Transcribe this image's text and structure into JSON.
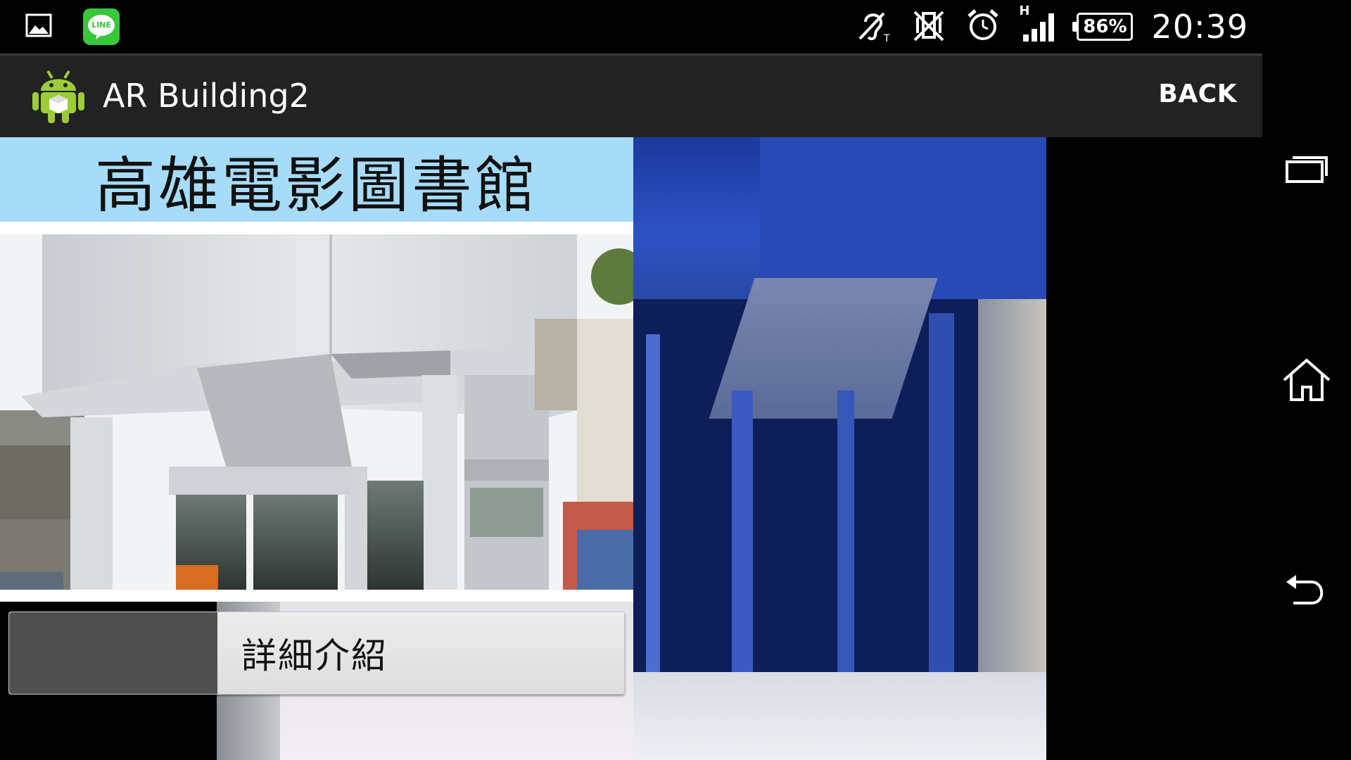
{
  "status_bar": {
    "time": "20:39",
    "battery": "86%",
    "network_type": "H",
    "icons": [
      "gallery-notification-icon",
      "line-app-icon",
      "hearing-aid-icon",
      "vibrate-off-icon",
      "alarm-icon",
      "signal-icon",
      "battery-icon"
    ],
    "line_label": "LINE"
  },
  "action_bar": {
    "app_title": "AR Building2",
    "back_label": "BACK"
  },
  "card": {
    "title": "高雄電影圖書館",
    "detail_button_label": "詳細介紹"
  },
  "nav_bar": {
    "buttons": [
      "recent-apps-icon",
      "home-icon",
      "back-icon"
    ]
  },
  "colors": {
    "title_banner": "#a6dbfa",
    "action_bar": "#222222",
    "status_bar": "#000000"
  }
}
